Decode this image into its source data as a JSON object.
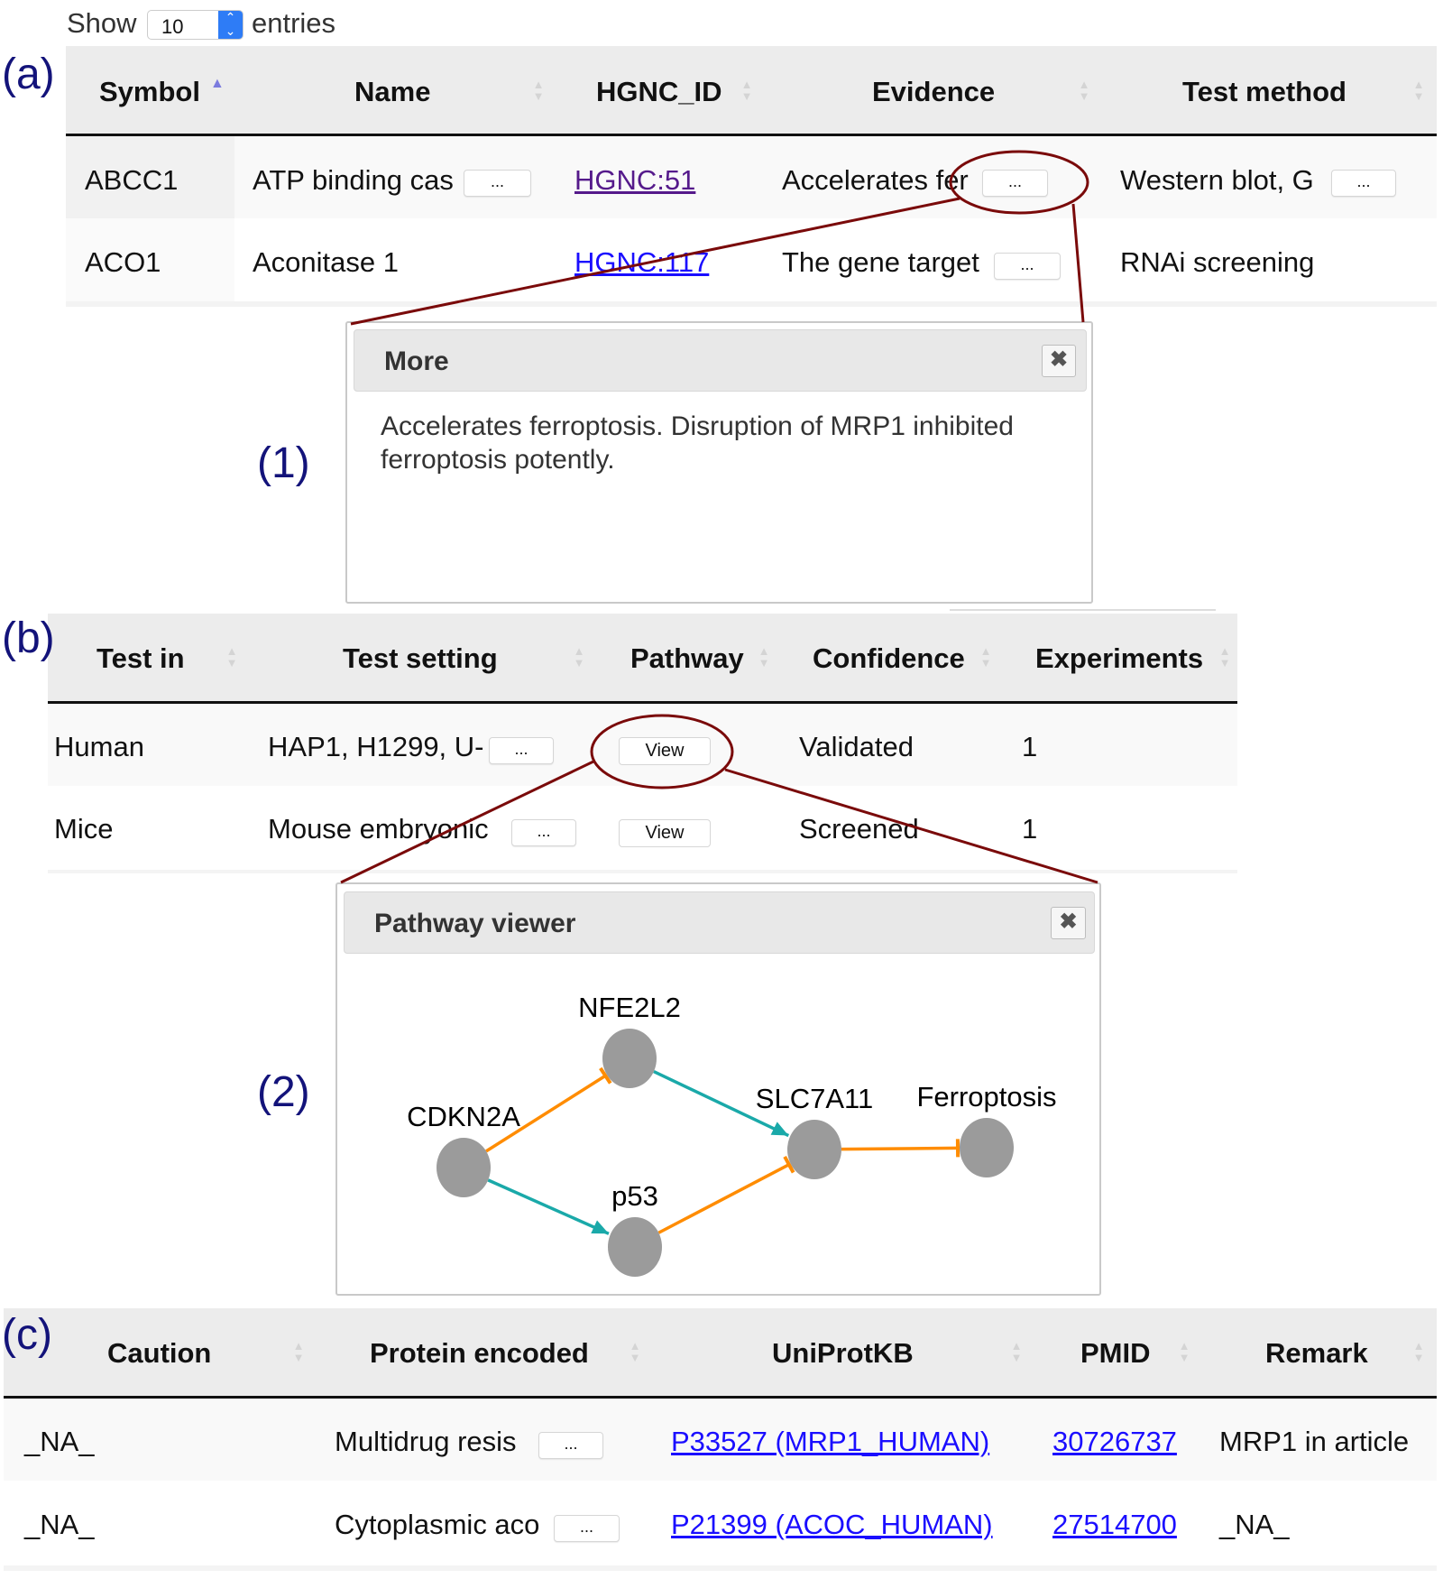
{
  "length_menu": {
    "show": "Show",
    "value": "10",
    "entries": "entries"
  },
  "labels": {
    "a": "(a)",
    "b": "(b)",
    "c": "(c)",
    "p1": "(1)",
    "p2": "(2)"
  },
  "more_button": "...",
  "table_a": {
    "headers": [
      "Symbol",
      "Name",
      "HGNC_ID",
      "Evidence",
      "Test method"
    ],
    "sorted_column": "Symbol",
    "rows": [
      {
        "symbol": "ABCC1",
        "name": "ATP binding cas",
        "hgnc": "HGNC:51",
        "evidence": "Accelerates fer",
        "method": "Western blot, G"
      },
      {
        "symbol": "ACO1",
        "name": "Aconitase 1",
        "hgnc": "HGNC:117",
        "evidence": "The gene target",
        "method": "RNAi screening"
      }
    ]
  },
  "popup_more": {
    "title": "More",
    "close": "✖",
    "lines": [
      "Accelerates ferroptosis. Disruption of MRP1 inhibited",
      "ferroptosis potently."
    ]
  },
  "table_b": {
    "headers": [
      "Test in",
      "Test setting",
      "Pathway",
      "Confidence",
      "Experiments"
    ],
    "view_label": "View",
    "rows": [
      {
        "test_in": "Human",
        "setting": "HAP1, H1299, U-",
        "confidence": "Validated",
        "experiments": "1"
      },
      {
        "test_in": "Mice",
        "setting": "Mouse embryonic",
        "confidence": "Screened",
        "experiments": "1"
      }
    ]
  },
  "popup_pathway": {
    "title": "Pathway viewer",
    "close": "✖",
    "nodes": [
      "CDKN2A",
      "NFE2L2",
      "p53",
      "SLC7A11",
      "Ferroptosis"
    ],
    "edges": [
      {
        "from": "CDKN2A",
        "to": "NFE2L2",
        "type": "inhibition"
      },
      {
        "from": "NFE2L2",
        "to": "SLC7A11",
        "type": "activation"
      },
      {
        "from": "CDKN2A",
        "to": "p53",
        "type": "activation"
      },
      {
        "from": "p53",
        "to": "SLC7A11",
        "type": "inhibition"
      },
      {
        "from": "SLC7A11",
        "to": "Ferroptosis",
        "type": "inhibition"
      }
    ],
    "colors": {
      "activation": "#1aa9a9",
      "inhibition": "#ff8c00",
      "node": "#9b9b9b"
    }
  },
  "table_c": {
    "headers": [
      "Caution",
      "Protein encoded",
      "UniProtKB",
      "PMID",
      "Remark"
    ],
    "rows": [
      {
        "caution": "_NA_",
        "protein": "Multidrug resis",
        "uniprot": "P33527 (MRP1_HUMAN)",
        "pmid": "30726737",
        "remark": "MRP1 in article"
      },
      {
        "caution": "_NA_",
        "protein": "Cytoplasmic aco",
        "uniprot": "P21399 (ACOC_HUMAN)",
        "pmid": "27514700",
        "remark": "_NA_"
      }
    ]
  },
  "colors": {
    "annotation": "#7a0a0a",
    "label": "#13137a",
    "link": "#1a0dff",
    "visited_link": "#551a8b"
  }
}
